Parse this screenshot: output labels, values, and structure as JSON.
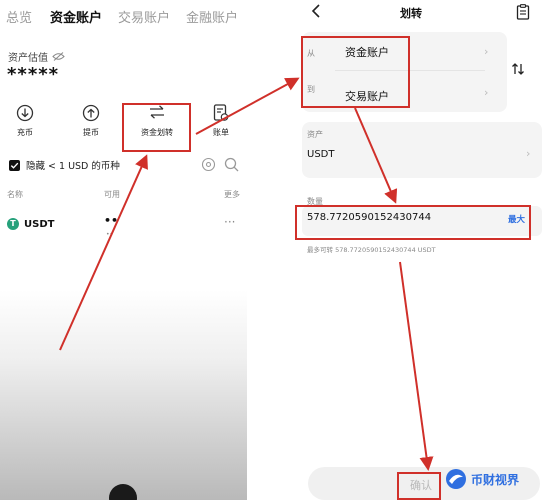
{
  "left": {
    "tabs": [
      "总览",
      "资金账户",
      "交易账户",
      "金融账户"
    ],
    "active_tab_index": 1,
    "asset_label": "资产估值",
    "asset_value": "*****",
    "actions": [
      {
        "label": "充币",
        "icon": "deposit-icon"
      },
      {
        "label": "提币",
        "icon": "withdraw-icon"
      },
      {
        "label": "资金划转",
        "icon": "transfer-icon"
      },
      {
        "label": "账单",
        "icon": "bill-icon"
      }
    ],
    "hide_small_label": "隐藏 < 1 USD 的币种",
    "columns": {
      "name": "名称",
      "available": "可用",
      "more": "更多"
    },
    "coin": {
      "name": "USDT",
      "available": "••",
      "sub": "••",
      "more": "···"
    }
  },
  "right": {
    "title": "划转",
    "from_label": "从",
    "from_account": "资金账户",
    "to_label": "到",
    "to_account": "交易账户",
    "asset_label": "资产",
    "asset_value": "USDT",
    "amount_label": "数量",
    "amount_value": "578.7720590152430744",
    "max_label": "最大",
    "max_transferable": "最多可转 578.7720590152430744 USDT",
    "confirm_label": "确认"
  },
  "watermark": "币财视界",
  "colors": {
    "annotation": "#d0302a",
    "accent": "#2f6fe0",
    "usdt_green": "#26a17b"
  }
}
